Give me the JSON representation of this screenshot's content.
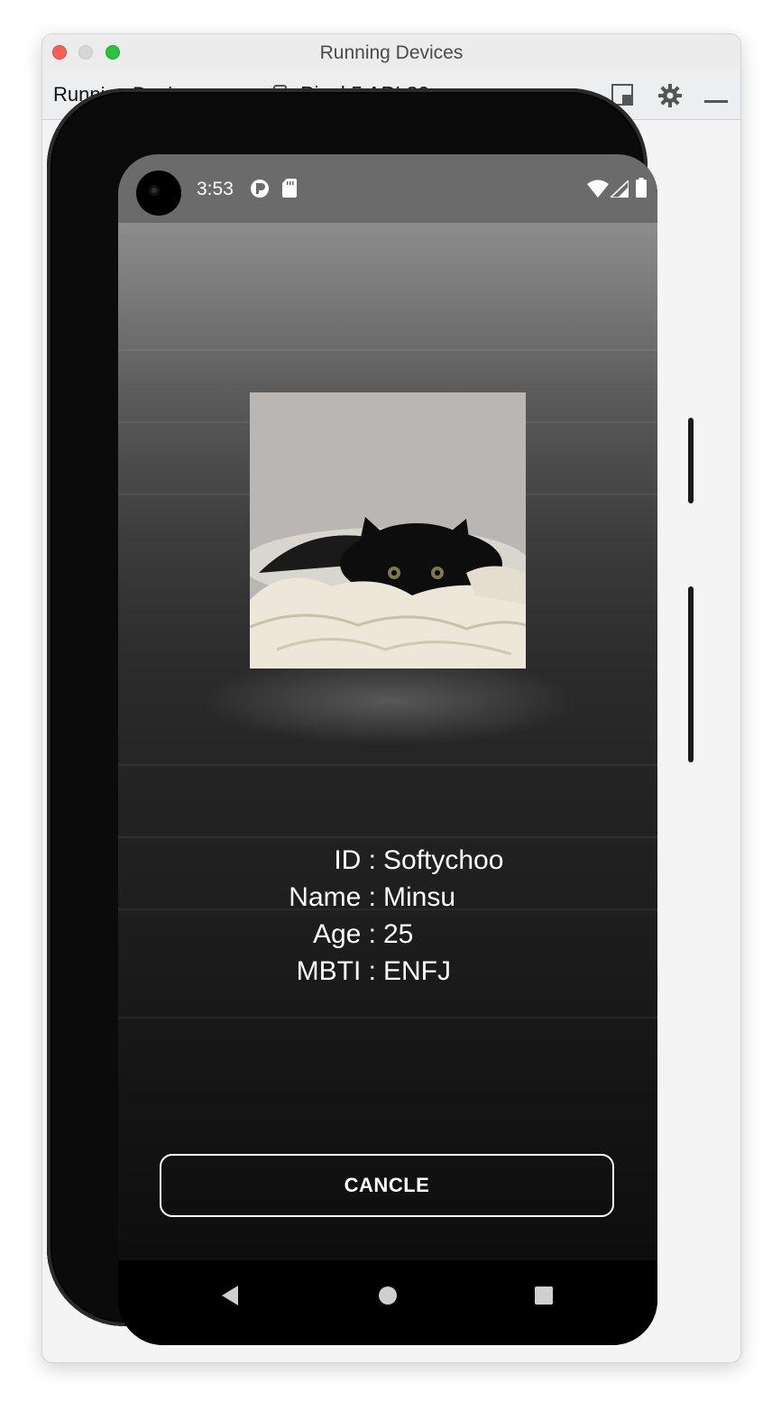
{
  "window": {
    "title": "Running Devices"
  },
  "tabbar": {
    "label": "Running Devices:",
    "device_tab": "Pixel 5 API 30",
    "close_symbol": "×"
  },
  "statusbar": {
    "time": "3:53"
  },
  "profile": {
    "rows": [
      {
        "label": "ID :",
        "value": "Softychoo"
      },
      {
        "label": "Name :",
        "value": "Minsu"
      },
      {
        "label": "Age :",
        "value": "25"
      },
      {
        "label": "MBTI :",
        "value": "ENFJ"
      }
    ]
  },
  "actions": {
    "cancel_label": "CANCLE"
  },
  "colors": {
    "tab_accent": "#3a74c9",
    "close_red": "#fe5f57",
    "zoom_green": "#29c33f"
  }
}
